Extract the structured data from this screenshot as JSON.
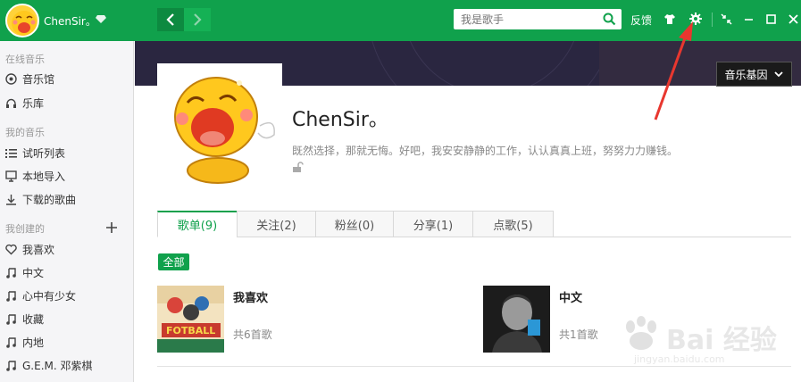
{
  "header": {
    "username": "ChenSir。",
    "search_placeholder": "我是歌手",
    "feedback": "反馈"
  },
  "sidebar": {
    "online_title": "在线音乐",
    "online_items": [
      {
        "label": "音乐馆",
        "icon": "music-hall-icon"
      },
      {
        "label": "乐库",
        "icon": "headphones-icon"
      }
    ],
    "my_title": "我的音乐",
    "my_items": [
      {
        "label": "试听列表",
        "icon": "list-icon"
      },
      {
        "label": "本地导入",
        "icon": "monitor-icon"
      },
      {
        "label": "下载的歌曲",
        "icon": "download-icon"
      }
    ],
    "created_title": "我创建的",
    "created_items": [
      {
        "label": "我喜欢",
        "icon": "heart-icon"
      },
      {
        "label": "中文",
        "icon": "note-icon"
      },
      {
        "label": "心中有少女",
        "icon": "note-icon"
      },
      {
        "label": "收藏",
        "icon": "note-icon"
      },
      {
        "label": "内地",
        "icon": "note-icon"
      },
      {
        "label": "G.E.M. 邓紫棋",
        "icon": "note-icon"
      }
    ]
  },
  "profile": {
    "name": "ChenSir。",
    "signature": "既然选择，那就无悔。好吧，我安安静静的工作，认认真真上班，努努力力赚钱。",
    "gene_button": "音乐基因"
  },
  "tabs": [
    {
      "label": "歌单(9)",
      "active": true
    },
    {
      "label": "关注(2)",
      "active": false
    },
    {
      "label": "粉丝(0)",
      "active": false
    },
    {
      "label": "分享(1)",
      "active": false
    },
    {
      "label": "点歌(5)",
      "active": false
    }
  ],
  "filter": {
    "all_label": "全部"
  },
  "playlists": [
    {
      "name": "我喜欢",
      "count": "共6首歌"
    },
    {
      "name": "中文",
      "count": "共1首歌"
    }
  ],
  "watermark": {
    "text": "Bai  经验",
    "sub": "jingyan.baidu.com"
  },
  "colors": {
    "accent": "#10a14c",
    "annotation_arrow": "#e8372f"
  }
}
